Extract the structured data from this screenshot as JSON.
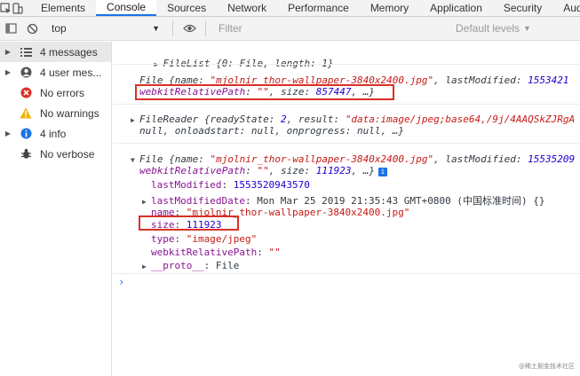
{
  "tabs": [
    "Elements",
    "Console",
    "Sources",
    "Network",
    "Performance",
    "Memory",
    "Application",
    "Security",
    "Aud"
  ],
  "active_tab": "Console",
  "toolbar": {
    "context": "top",
    "filter_placeholder": "Filter",
    "levels_label": "Default levels"
  },
  "sidebar": {
    "items": [
      {
        "label": "4 messages",
        "icon": "list-icon"
      },
      {
        "label": "4 user mes...",
        "icon": "user-icon"
      },
      {
        "label": "No errors",
        "icon": "error-icon"
      },
      {
        "label": "No warnings",
        "icon": "warning-icon"
      },
      {
        "label": "4 info",
        "icon": "info-icon"
      },
      {
        "label": "No verbose",
        "icon": "bug-icon"
      }
    ]
  },
  "console": {
    "filelist": {
      "text": "FileList {0: File, length: 1}"
    },
    "file1": {
      "line1_pre": "File {name: ",
      "line1_name": "\"mjolnir_thor-wallpaper-3840x2400.jpg\"",
      "line1_mid": ", lastModified: ",
      "line1_num": "1553421",
      "line2_key": "webkitRelativePath",
      "line2_val": "\"\"",
      "line2_sizekey": ", size: ",
      "line2_size": "857447",
      "line2_end": ", …}"
    },
    "reader": {
      "line1_pre": "FileReader {readyState: ",
      "line1_state": "2",
      "line1_mid": ", result: ",
      "line1_result": "\"data:image/jpeg;base64,/9j/4AAQSkZJRgA",
      "line2": "null, onloadstart: null, onprogress: null, …}"
    },
    "file2": {
      "line1_pre": "File {name: ",
      "line1_name": "\"mjolnir_thor-wallpaper-3840x2400.jpg\"",
      "line1_mid": ", lastModified: ",
      "line1_num": "15535209",
      "line2_key": "webkitRelativePath",
      "line2_val": "\"\"",
      "line2_sizekey": ", size: ",
      "line2_size": "111923",
      "line2_end": ", …}",
      "props": {
        "lastModified_key": "lastModified",
        "lastModified_val": "1553520943570",
        "lastModifiedDate_key": "lastModifiedDate",
        "lastModifiedDate_val": "Mon Mar 25 2019 21:35:43 GMT+0800 (中国标准时间) {}",
        "name_key": "name",
        "name_val": "\"mjolnir_thor-wallpaper-3840x2400.jpg\"",
        "size_key": "size",
        "size_val": "111923",
        "type_key": "type",
        "type_val": "\"image/jpeg\"",
        "wrp_key": "webkitRelativePath",
        "wrp_val": "\"\"",
        "proto_key": "__proto__",
        "proto_val": "File"
      }
    },
    "prompt": "›"
  },
  "watermark": "@稀土掘金技术社区",
  "colors": {
    "highlight_box": "#d93025",
    "accent": "#1a73e8"
  }
}
